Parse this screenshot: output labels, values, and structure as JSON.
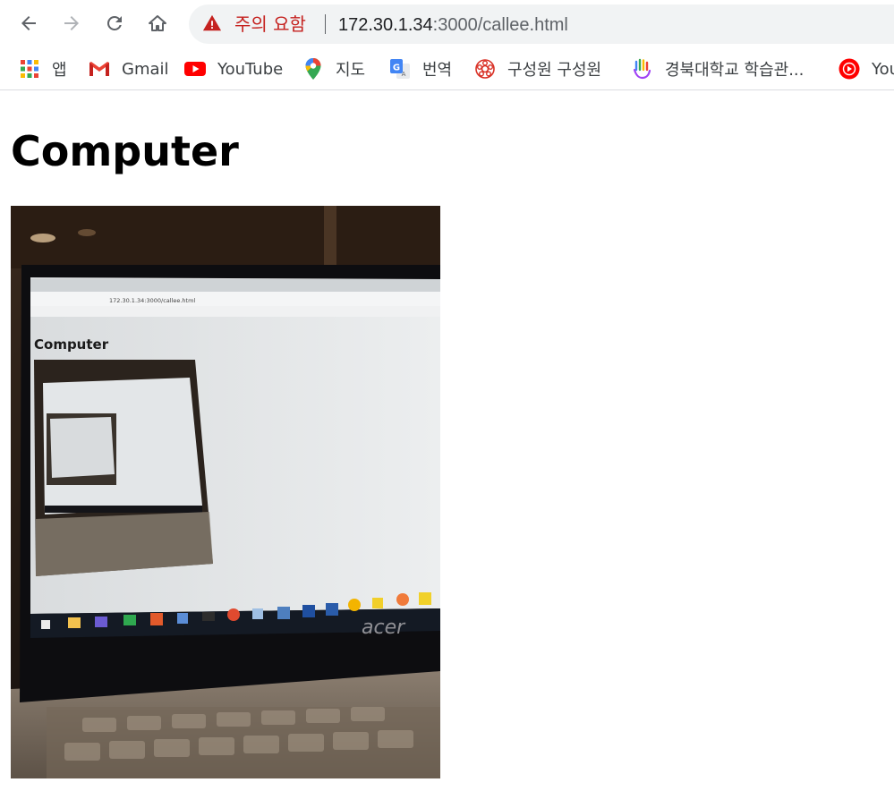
{
  "browser": {
    "security_warning": "주의 요함",
    "url_host": "172.30.1.34",
    "url_path": ":3000/callee.html"
  },
  "bookmarks": [
    {
      "label": "앱",
      "icon": "apps-grid-icon"
    },
    {
      "label": "Gmail",
      "icon": "gmail-icon"
    },
    {
      "label": "YouTube",
      "icon": "youtube-icon"
    },
    {
      "label": "지도",
      "icon": "maps-pin-icon"
    },
    {
      "label": "번역",
      "icon": "translate-icon"
    },
    {
      "label": "구성원 구성원",
      "icon": "emblem-icon"
    },
    {
      "label": "경북대학교 학습관...",
      "icon": "hand-logo-icon"
    },
    {
      "label": "You",
      "icon": "youtube-music-icon"
    }
  ],
  "page": {
    "heading": "Computer"
  },
  "video_feed": {
    "inner_heading": "Computer",
    "inner_url": "172.30.1.34:3000/callee.html",
    "laptop_brand": "acer"
  }
}
